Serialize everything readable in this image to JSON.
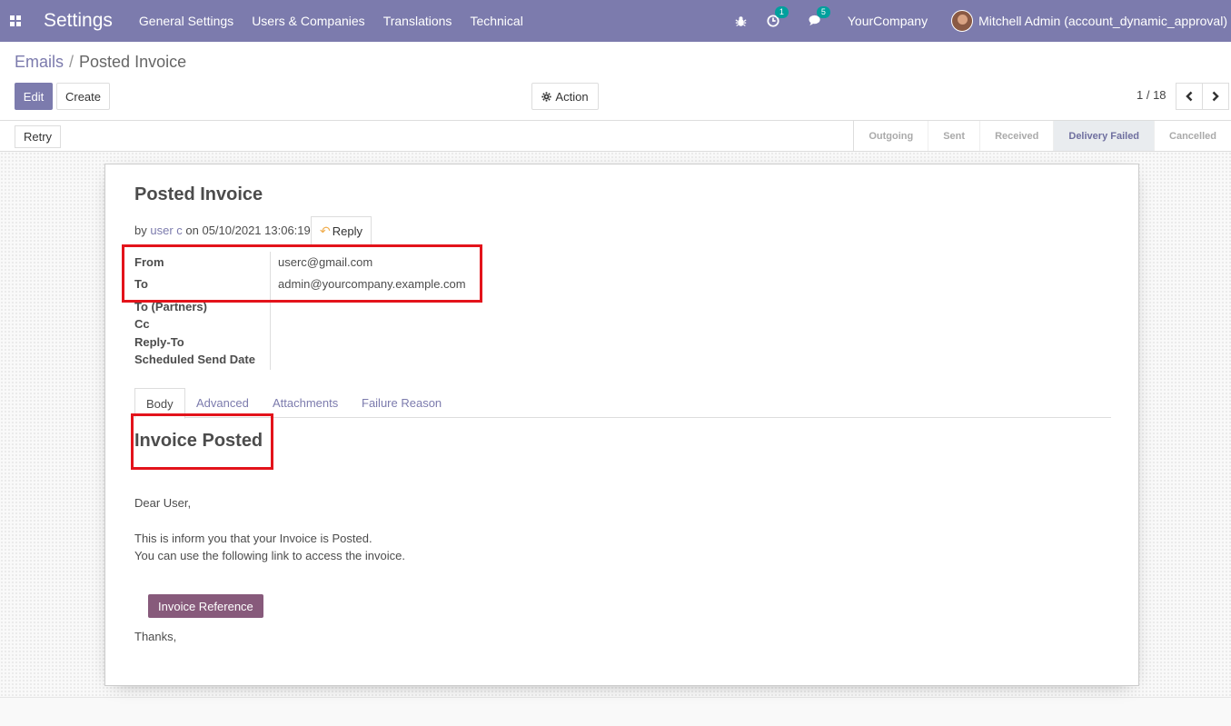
{
  "topbar": {
    "brand": "Settings",
    "menu": [
      "General Settings",
      "Users & Companies",
      "Translations",
      "Technical"
    ],
    "activity_count": "1",
    "message_count": "5",
    "company": "YourCompany",
    "user": "Mitchell Admin (account_dynamic_approval)"
  },
  "breadcrumb": {
    "parent": "Emails",
    "separator": "/",
    "current": "Posted Invoice"
  },
  "controls": {
    "edit_label": "Edit",
    "create_label": "Create",
    "action_label": "Action",
    "pager_value": "1 / 18"
  },
  "statusbar": {
    "retry_label": "Retry",
    "stages": [
      "Outgoing",
      "Sent",
      "Received",
      "Delivery Failed",
      "Cancelled"
    ],
    "current_stage": "Delivery Failed"
  },
  "mail": {
    "subject": "Posted Invoice",
    "by_prefix": "by",
    "author": "user c",
    "on_text": "on 05/10/2021 13:06:19",
    "reply_label": "Reply",
    "fields": [
      {
        "label": "From",
        "value": "userc@gmail.com"
      },
      {
        "label": "To",
        "value": "admin@yourcompany.example.com"
      },
      {
        "label": "To (Partners)",
        "value": ""
      },
      {
        "label": "Cc",
        "value": ""
      },
      {
        "label": "Reply-To",
        "value": ""
      },
      {
        "label": "Scheduled Send Date",
        "value": ""
      }
    ],
    "tabs": [
      "Body",
      "Advanced",
      "Attachments",
      "Failure Reason"
    ],
    "active_tab": "Body",
    "body": {
      "heading": "Invoice Posted",
      "greeting": "Dear User,",
      "line1": "This is inform you that your Invoice is Posted.",
      "line2": "You can use the following link to access the invoice.",
      "button_label": "Invoice Reference",
      "closing": "Thanks,"
    }
  },
  "colors": {
    "primary": "#7c7bad",
    "accent_button": "#875a7b",
    "highlight": "#e3131b",
    "badge": "#00a09d"
  }
}
